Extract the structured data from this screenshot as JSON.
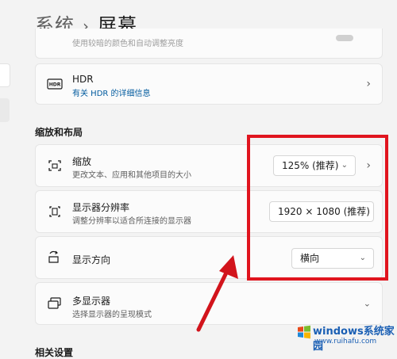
{
  "breadcrumb": {
    "parent": "系统",
    "separator": "›",
    "current": "屏幕"
  },
  "top_partial": {
    "subtitle": "使用较暗的颜色和自动调整亮度"
  },
  "hdr": {
    "badge": "HDR",
    "title": "HDR",
    "subtitle": "有关 HDR 的详细信息"
  },
  "section": {
    "title": "缩放和布局"
  },
  "rows": {
    "scale": {
      "title": "缩放",
      "subtitle": "更改文本、应用和其他项目的大小",
      "value": "125% (推荐)"
    },
    "resolution": {
      "title": "显示器分辨率",
      "subtitle": "调整分辨率以适合所连接的显示器",
      "value": "1920 × 1080 (推荐)"
    },
    "orientation": {
      "title": "显示方向",
      "value": "横向"
    },
    "multi": {
      "title": "多显示器",
      "subtitle": "选择显示器的呈现模式"
    }
  },
  "bottom_partial": {
    "title": "相关设置"
  },
  "watermark": {
    "title": "windows系统家园",
    "sub": "www.ruihafu.com",
    "url": ""
  },
  "colors": {
    "accent": "#005a9e",
    "highlight": "#e0141e",
    "arrow": "#d2141c"
  }
}
